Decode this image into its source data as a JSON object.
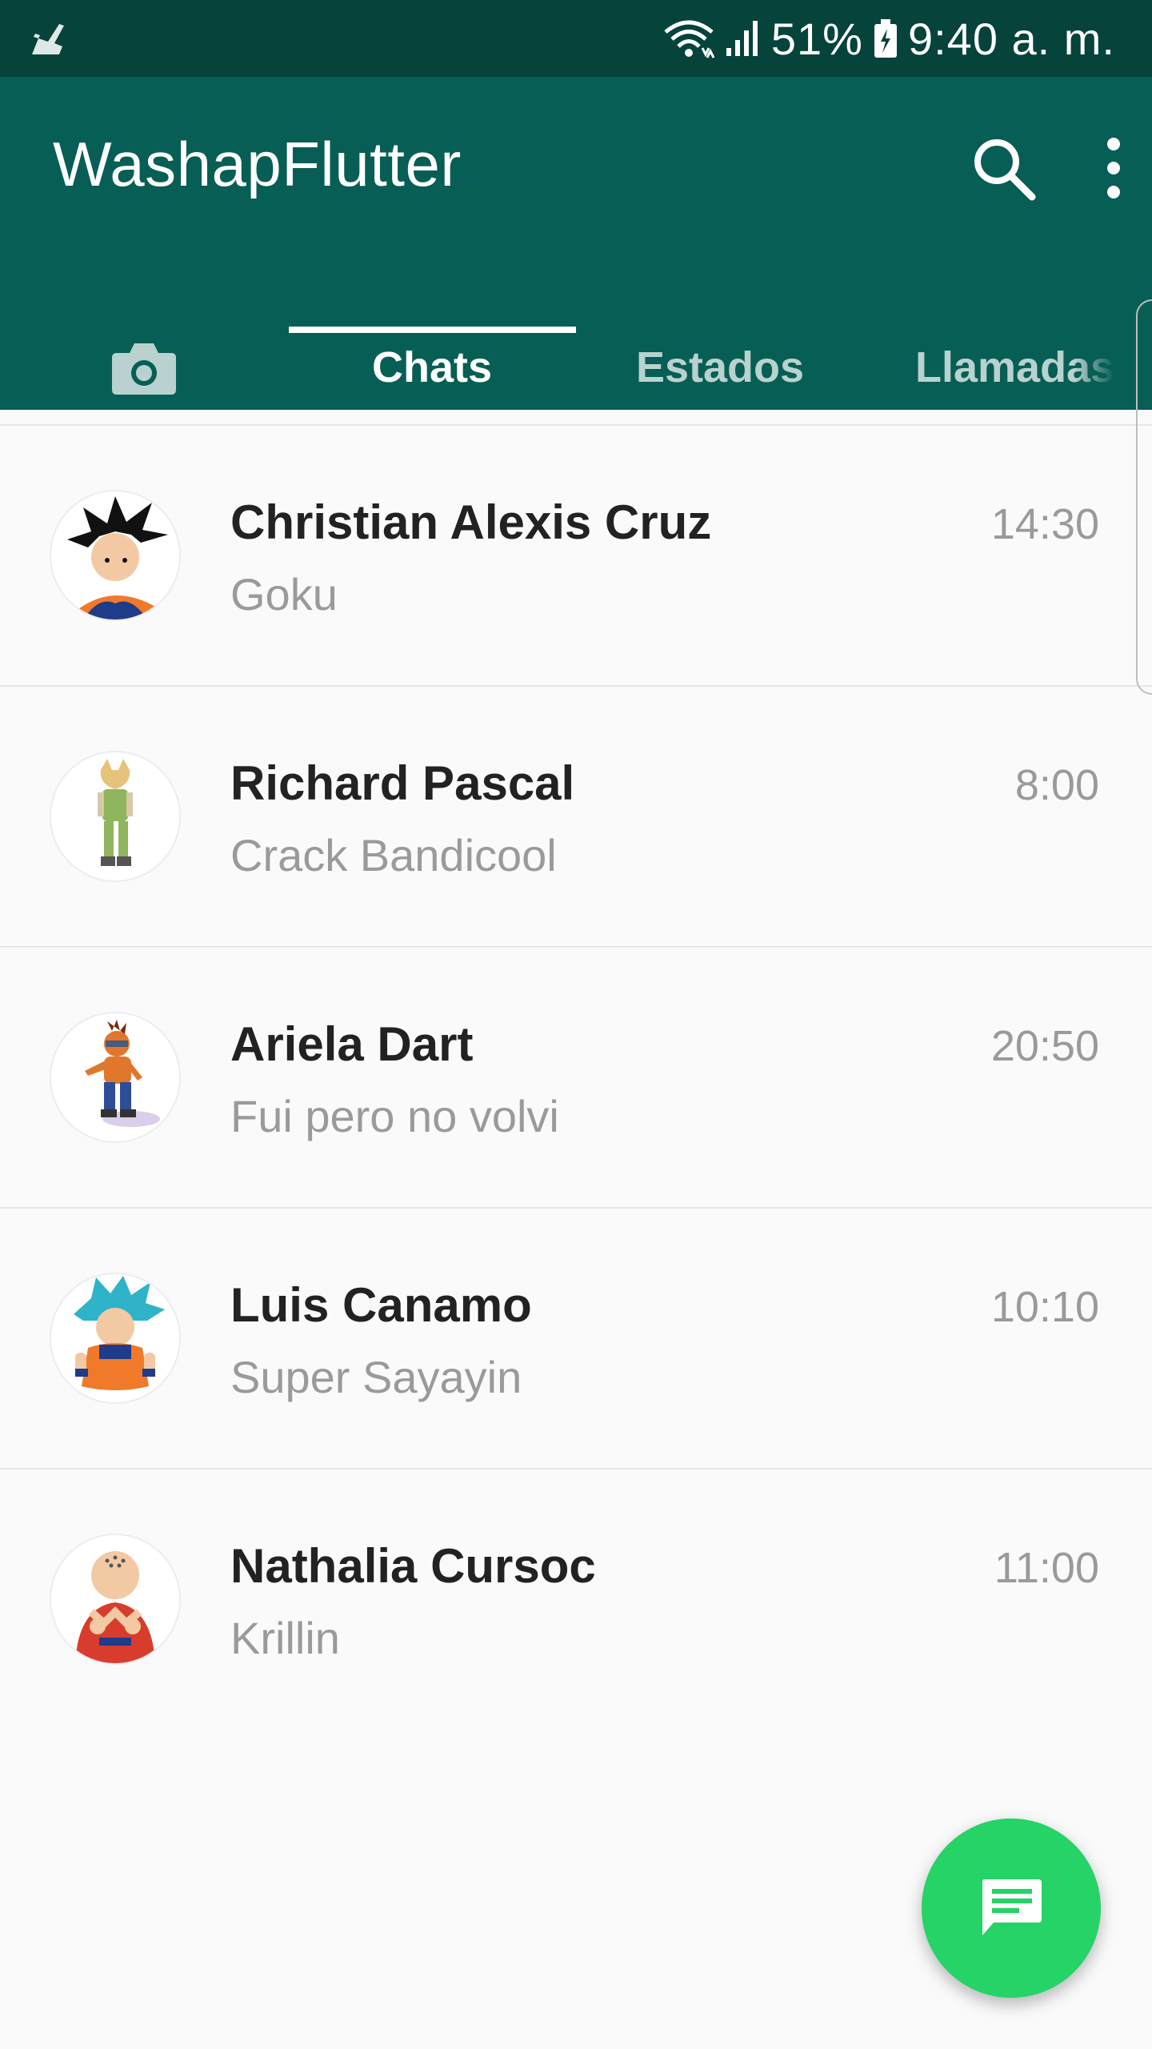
{
  "status_bar": {
    "battery": "51%",
    "time": "9:40 a. m."
  },
  "app_bar": {
    "title": "WashapFlutter",
    "search_icon": "search-icon",
    "more_icon": "more-vert-icon",
    "background_color": "#075e54",
    "status_color": "#05433b"
  },
  "tabs": [
    {
      "label": "",
      "icon": "camera-icon"
    },
    {
      "label": "Chats",
      "active": true
    },
    {
      "label": "Estados"
    },
    {
      "label": "Llamadas"
    }
  ],
  "chats": [
    {
      "name": "Christian Alexis Cruz",
      "message": "Goku",
      "time": "14:30",
      "avatar": "goku-avatar"
    },
    {
      "name": "Richard Pascal",
      "message": "Crack Bandicool",
      "time": "8:00",
      "avatar": "fox-avatar"
    },
    {
      "name": "Ariela Dart",
      "message": "Fui pero no volvi",
      "time": "20:50",
      "avatar": "crash-avatar"
    },
    {
      "name": "Luis Canamo",
      "message": "Super Sayayin",
      "time": "10:10",
      "avatar": "goku-ssb-avatar"
    },
    {
      "name": "Nathalia Cursoc",
      "message": "Krillin",
      "time": "11:00",
      "avatar": "krillin-avatar"
    }
  ],
  "fab": {
    "icon": "message-icon",
    "color": "#25d366"
  }
}
